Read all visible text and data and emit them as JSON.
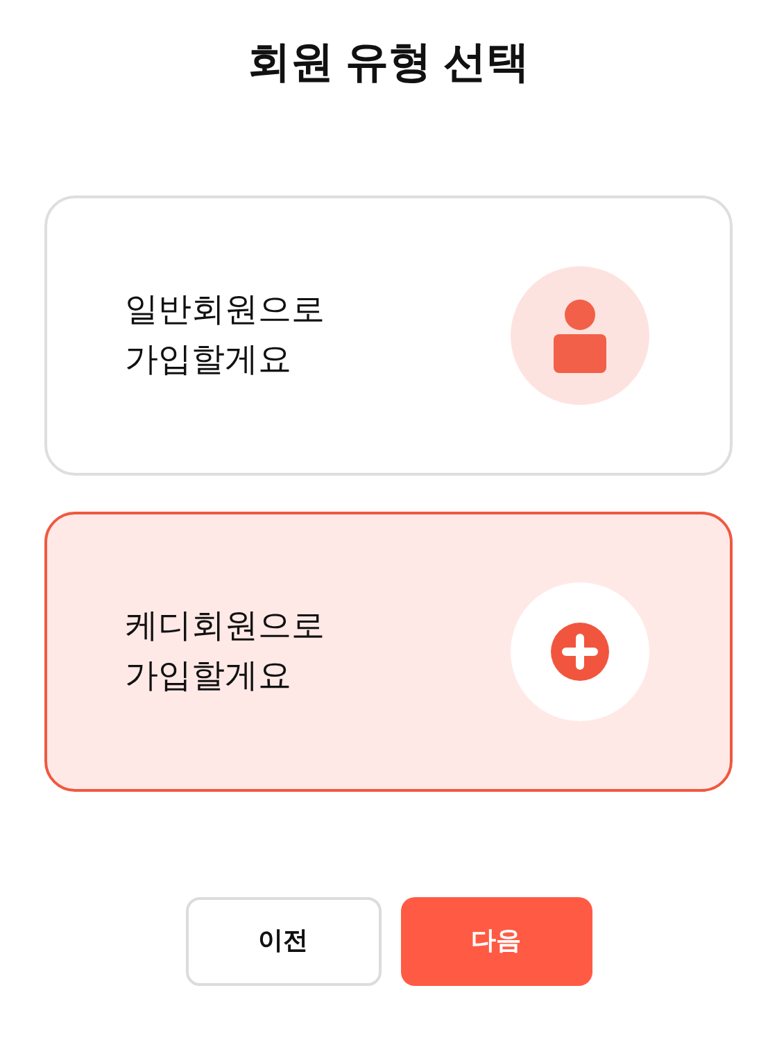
{
  "title": "회원 유형 선택",
  "options": [
    {
      "label": "일반회원으로\n가입할게요",
      "kind": "person",
      "selected": false
    },
    {
      "label": "케디회원으로\n가입할게요",
      "kind": "plus",
      "selected": true
    }
  ],
  "buttons": [
    {
      "label": "이전",
      "kind": "secondary"
    },
    {
      "label": "다음",
      "kind": "primary"
    }
  ]
}
